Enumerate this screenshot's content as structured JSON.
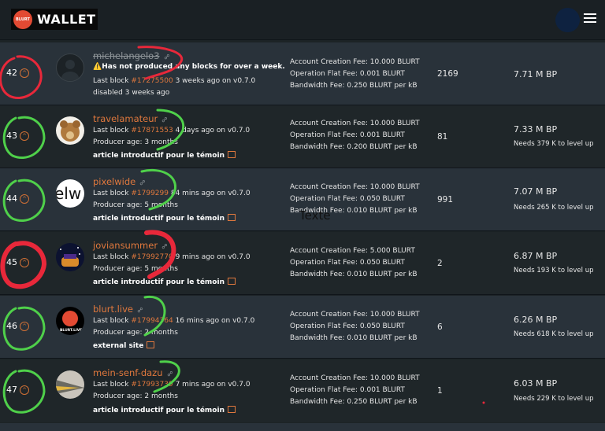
{
  "header": {
    "brand": "WALLET",
    "badge": "BLURT"
  },
  "witnesses": [
    {
      "rank": "42",
      "name": "michelangelo3",
      "warning": "⚠️Has not produced any blocks for over a week.",
      "last_block_prefix": "Last block ",
      "last_block": "#17275500",
      "last_block_suffix": " 3 weeks ago on v0.7.0",
      "sub": "disabled 3 weeks ago",
      "fees": [
        "Account Creation Fee: 10.000 BLURT",
        "Operation Flat Fee: 0.001 BLURT",
        "Bandwidth Fee: 0.250 BLURT per kB"
      ],
      "count": "2169",
      "bp": "7.71 M BP",
      "level": ""
    },
    {
      "rank": "43",
      "name": "travelamateur",
      "last_block_prefix": "Last block ",
      "last_block": "#17871553",
      "last_block_suffix": " 4 days ago on v0.7.0",
      "sub": "Producer age: 3 months",
      "article": "article introductif pour le témoin",
      "fees": [
        "Account Creation Fee: 10.000 BLURT",
        "Operation Flat Fee: 0.001 BLURT",
        "Bandwidth Fee: 0.200 BLURT per kB"
      ],
      "count": "81",
      "bp": "7.33 M BP",
      "level": "Needs 379 K to level up"
    },
    {
      "rank": "44",
      "name": "pixelwide",
      "last_block_prefix": "Last block ",
      "last_block": "#1799299",
      "last_block_suffix": " 84 mins ago on v0.7.0",
      "sub": "Producer age: 5 months",
      "article": "article introductif pour le témoin",
      "fees": [
        "Account Creation Fee: 10.000 BLURT",
        "Operation Flat Fee: 0.050 BLURT",
        "Bandwidth Fee: 0.010 BLURT per kB"
      ],
      "count": "991",
      "bp": "7.07 M BP",
      "level": "Needs 265 K to level up"
    },
    {
      "rank": "45",
      "name": "joviansummer",
      "last_block_prefix": "Last block ",
      "last_block": "#17992770",
      "last_block_suffix": " 9 mins ago on v0.7.0",
      "sub": "Producer age: 5 months",
      "article": "article introductif pour le témoin",
      "fees": [
        "Account Creation Fee: 5.000 BLURT",
        "Operation Flat Fee: 0.050 BLURT",
        "Bandwidth Fee: 0.010 BLURT per kB"
      ],
      "count": "2",
      "bp": "6.87 M BP",
      "level": "Needs 193 K to level up"
    },
    {
      "rank": "46",
      "name": "blurt.live",
      "last_block_prefix": "Last block ",
      "last_block": "#17994364",
      "last_block_suffix": " 16 mins ago on v0.7.0",
      "sub": "Producer age: 2 months",
      "article": "external site",
      "fees": [
        "Account Creation Fee: 10.000 BLURT",
        "Operation Flat Fee: 0.050 BLURT",
        "Bandwidth Fee: 0.010 BLURT per kB"
      ],
      "count": "6",
      "bp": "6.26 M BP",
      "level": "Needs 618 K to level up"
    },
    {
      "rank": "47",
      "name": "mein-senf-dazu",
      "last_block_prefix": "Last block ",
      "last_block": "#17993739",
      "last_block_suffix": " 7 mins ago on v0.7.0",
      "sub": "Producer age: 2 months",
      "article": "article introductif pour le témoin",
      "fees": [
        "Account Creation Fee: 10.000 BLURT",
        "Operation Flat Fee: 0.001 BLURT",
        "Bandwidth Fee: 0.250 BLURT per kB"
      ],
      "count": "1",
      "bp": "6.03 M BP",
      "level": "Needs 229 K to level up"
    }
  ],
  "overlay_text": "Texte",
  "colors": {
    "accent": "#e0783d",
    "annotation_green": "#4fd04a",
    "annotation_red": "#e8283a"
  }
}
